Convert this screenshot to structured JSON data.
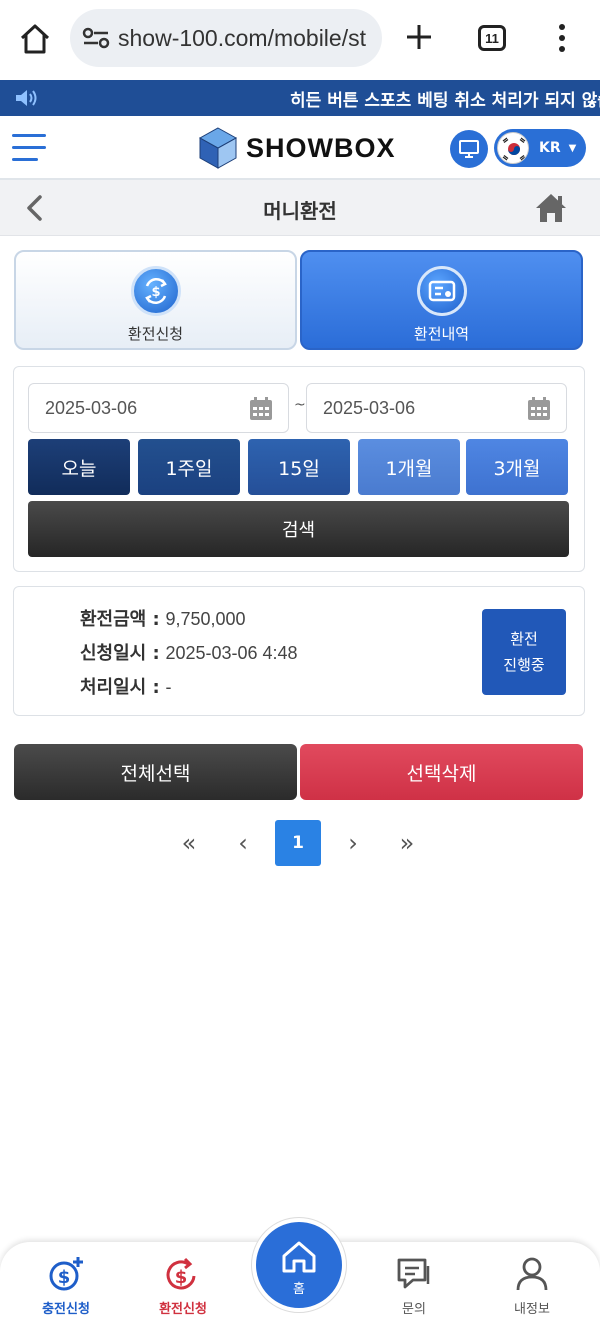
{
  "browser": {
    "url": "show-100.com/mobile/st",
    "tab_count": "11"
  },
  "notice": {
    "text": "히든 버튼 스포츠 베팅 취소 처리가 되지 않습"
  },
  "header": {
    "logo_text": "SHOWBOX",
    "language": "KR"
  },
  "page": {
    "title": "머니환전"
  },
  "tabs": [
    {
      "label": "환전신청",
      "icon": "dollar-exchange-icon"
    },
    {
      "label": "환전내역",
      "icon": "list-history-icon"
    }
  ],
  "search": {
    "date_from": "2025-03-06",
    "date_to": "2025-03-06",
    "separator": "~",
    "periods": [
      "오늘",
      "1주일",
      "15일",
      "1개월",
      "3개월"
    ],
    "search_label": "검색"
  },
  "record": {
    "amount_label": "환전금액 :",
    "amount_value": "9,750,000",
    "request_label": "신청일시 :",
    "request_value": "2025-03-06 4:48",
    "process_label": "처리일시 :",
    "process_value": "-",
    "status": "환전\n진행중"
  },
  "actions": {
    "select_all": "전체선택",
    "delete_selected": "선택삭제"
  },
  "pagination": {
    "first": "«",
    "prev": "‹",
    "current": "1",
    "next": "›",
    "last": "»"
  },
  "bottom_nav": [
    {
      "label": "충전신청",
      "icon": "dollar-plus-icon"
    },
    {
      "label": "환전신청",
      "icon": "dollar-return-icon"
    },
    {
      "label": "홈",
      "icon": "home-icon"
    },
    {
      "label": "문의",
      "icon": "chat-icon"
    },
    {
      "label": "내정보",
      "icon": "user-icon"
    }
  ],
  "colors": {
    "primary_blue": "#2a6ed8",
    "dark_navy": "#1d3f78",
    "delete_red": "#d83a4e",
    "notice_bg": "#1f4e96"
  }
}
